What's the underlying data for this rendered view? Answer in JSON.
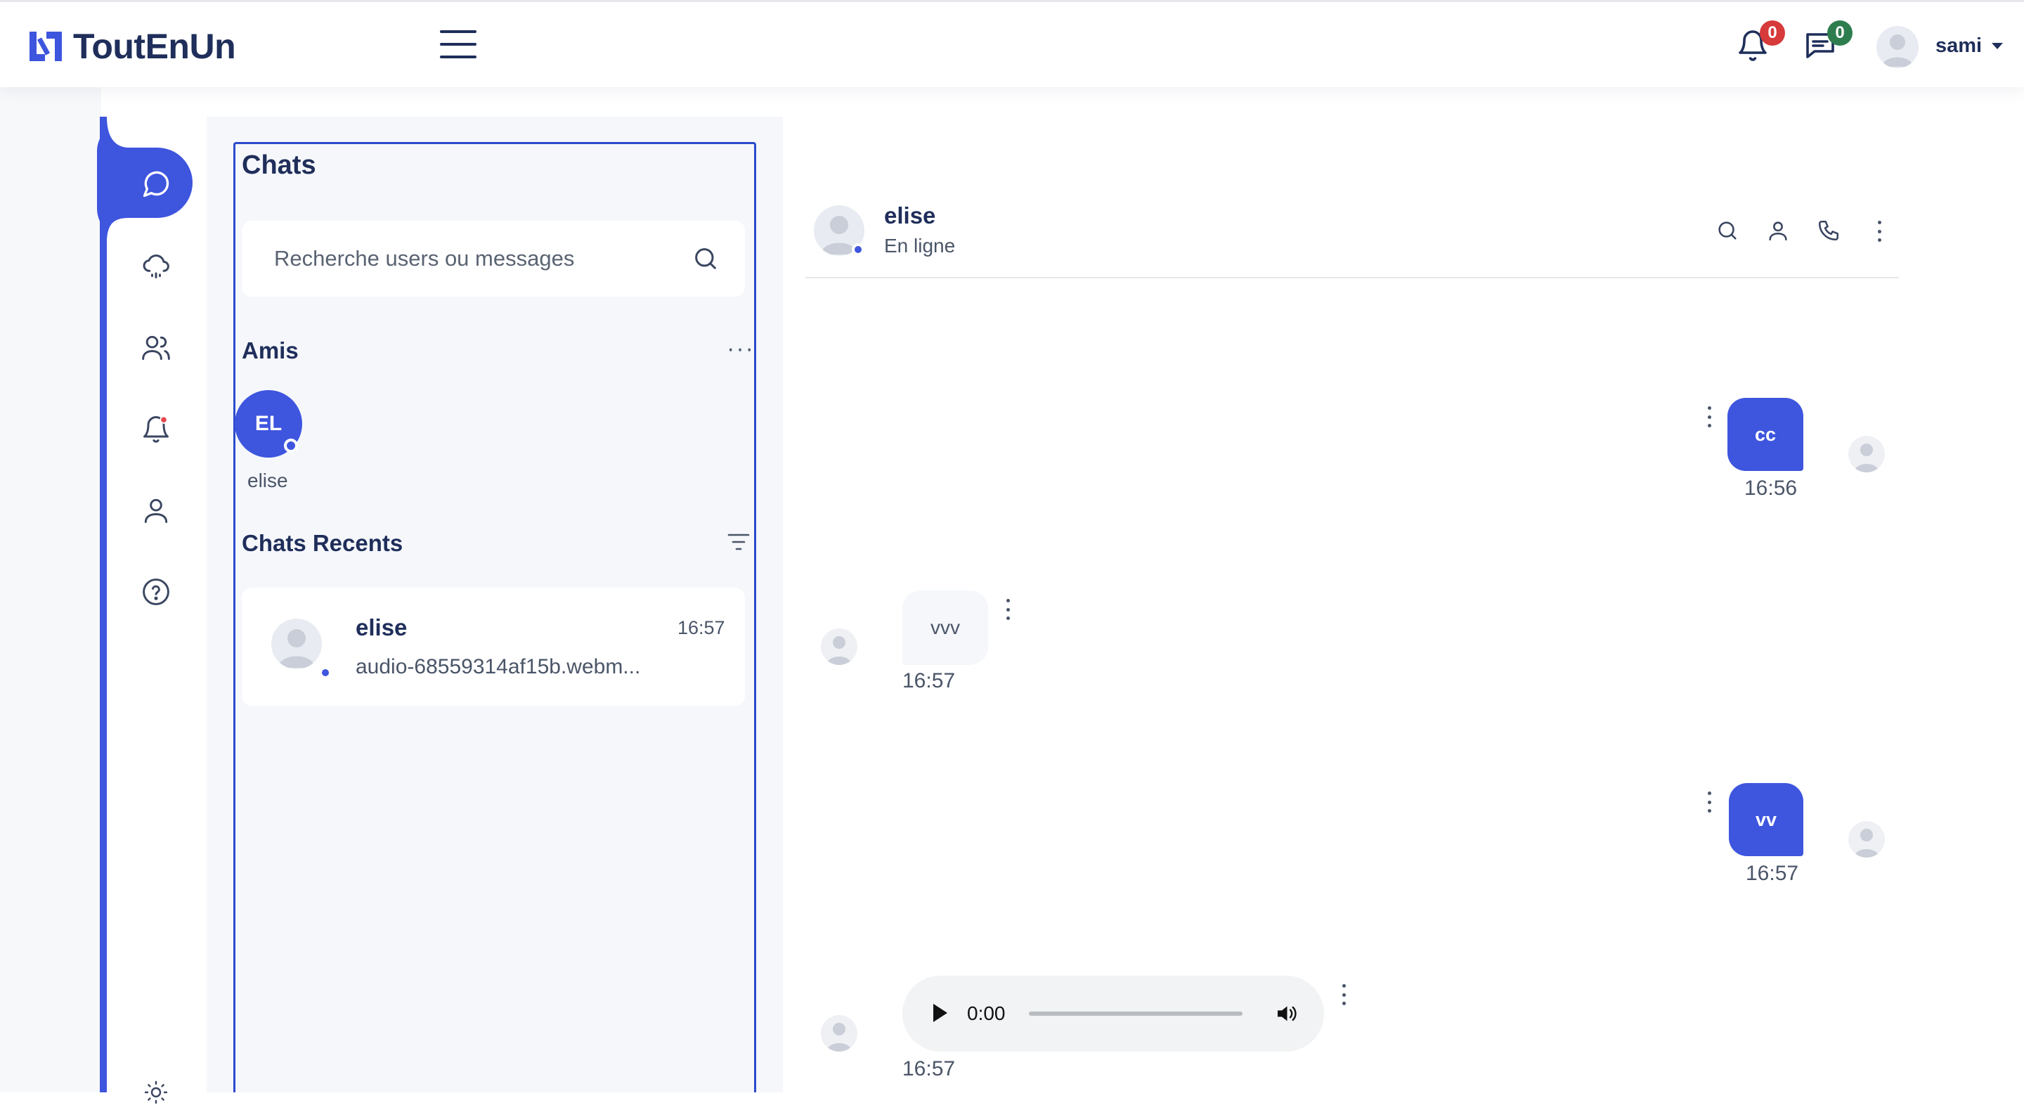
{
  "header": {
    "logo_text": "ToutEnUn",
    "notifications_count": "0",
    "messages_count": "0",
    "user_name": "sami"
  },
  "nav": {
    "items": [
      "chat-icon",
      "cloud-icon",
      "users-icon",
      "bell-icon",
      "profile-icon",
      "help-icon"
    ],
    "accent": "#3e55de"
  },
  "chat_list": {
    "title": "Chats",
    "search_placeholder": "Recherche users ou messages",
    "friends_title": "Amis",
    "friends": [
      {
        "initials": "EL",
        "name": "elise"
      }
    ],
    "recent_title": "Chats Recents",
    "recent": [
      {
        "name": "elise",
        "time": "16:57",
        "preview": "audio-68559314af15b.webm..."
      }
    ]
  },
  "conversation": {
    "contact_name": "elise",
    "contact_status": "En ligne",
    "messages": [
      {
        "direction": "out",
        "text": "cc",
        "time": "16:56"
      },
      {
        "direction": "in",
        "text": "vvv",
        "time": "16:57"
      },
      {
        "direction": "out",
        "text": "vv",
        "time": "16:57"
      },
      {
        "direction": "in",
        "type": "audio",
        "player_time": "0:00",
        "time": "16:57"
      }
    ]
  }
}
